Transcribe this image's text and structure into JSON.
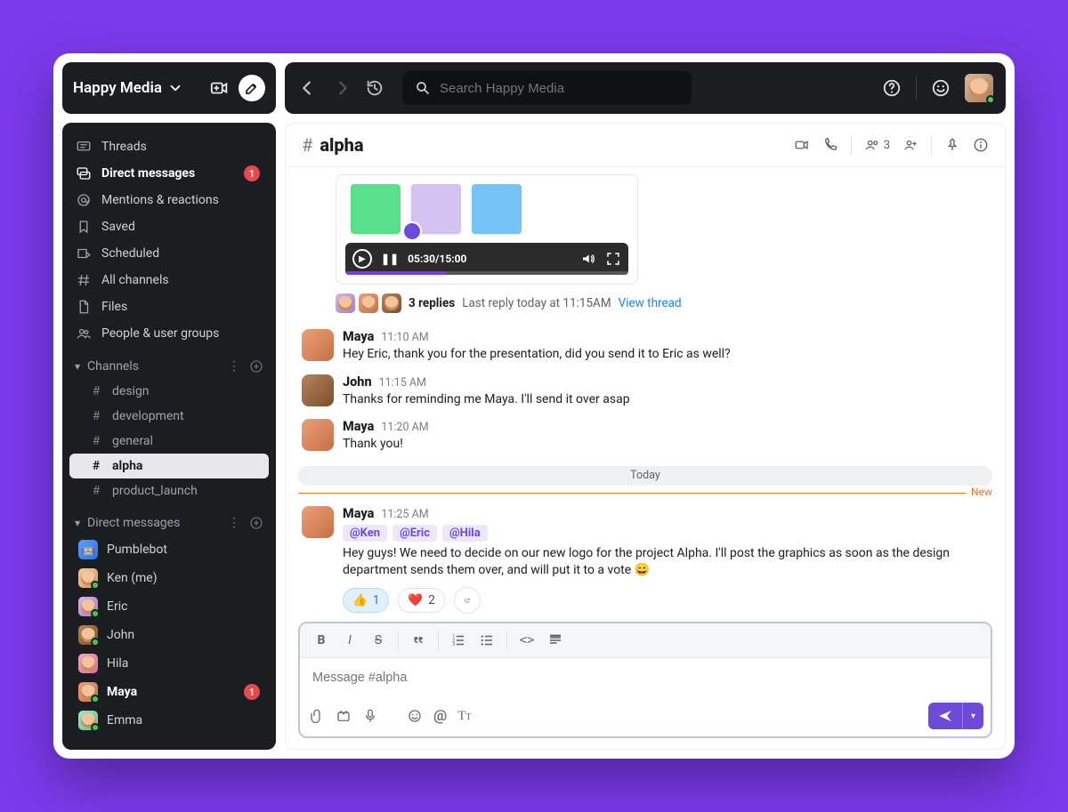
{
  "workspace": {
    "name": "Happy Media"
  },
  "search": {
    "placeholder": "Search Happy Media"
  },
  "sidebar": {
    "nav": [
      {
        "label": "Threads"
      },
      {
        "label": "Direct messages",
        "bold": true,
        "badge": "1"
      },
      {
        "label": "Mentions & reactions"
      },
      {
        "label": "Saved"
      },
      {
        "label": "Scheduled"
      },
      {
        "label": "All channels"
      },
      {
        "label": "Files"
      },
      {
        "label": "People & user groups"
      }
    ],
    "channels_label": "Channels",
    "channels": [
      {
        "name": "design"
      },
      {
        "name": "development"
      },
      {
        "name": "general"
      },
      {
        "name": "alpha",
        "active": true
      },
      {
        "name": "product_launch"
      }
    ],
    "dms_label": "Direct messages",
    "dms": [
      {
        "name": "Pumblebot"
      },
      {
        "name": "Ken (me)"
      },
      {
        "name": "Eric"
      },
      {
        "name": "John"
      },
      {
        "name": "Hila"
      },
      {
        "name": "Maya",
        "bold": true,
        "badge": "1"
      },
      {
        "name": "Emma"
      }
    ]
  },
  "channel": {
    "name": "alpha",
    "members": "3",
    "video_time": "05:30/15:00",
    "thread": {
      "replies": "3 replies",
      "last": "Last reply today at 11:15AM",
      "link": "View thread"
    },
    "daysep": "Today",
    "newlabel": "New",
    "messages": [
      {
        "name": "Maya",
        "time": "11:10 AM",
        "text": "Hey Eric, thank you for the presentation, did you send it to Eric as well?",
        "av": "av-maya"
      },
      {
        "name": "John",
        "time": "11:15 AM",
        "text": "Thanks for reminding me Maya. I'll send it over asap",
        "av": "av-john"
      },
      {
        "name": "Maya",
        "time": "11:20 AM",
        "text": "Thank you!",
        "av": "av-maya"
      }
    ],
    "newmsg": {
      "name": "Maya",
      "time": "11:25 AM",
      "av": "av-maya",
      "mentions": [
        "@Ken",
        "@Eric",
        "@Hila"
      ],
      "text": "Hey guys! We need to decide on our new logo for the project Alpha. I'll post the graphics as soon as the design department sends them over, and will put it to a vote 😄",
      "reactions": [
        {
          "emoji": "👍",
          "count": "1",
          "selected": true
        },
        {
          "emoji": "❤️",
          "count": "2",
          "selected": false
        }
      ]
    }
  },
  "composer": {
    "placeholder": "Message #alpha"
  },
  "colors": {
    "sticky_green": "#5adf8b",
    "sticky_lilac": "#d4c2f2",
    "sticky_blue": "#73c3f7",
    "accent": "#6d4bd8"
  }
}
